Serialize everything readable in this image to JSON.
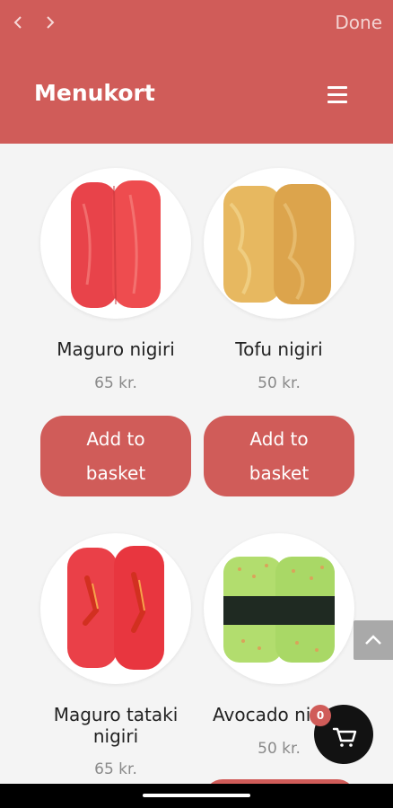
{
  "browser": {
    "back_icon": "chevron-left-icon",
    "forward_icon": "chevron-right-icon",
    "done_label": "Done"
  },
  "header": {
    "title": "Menukort",
    "menu_icon": "hamburger-icon"
  },
  "products": [
    {
      "name": "Maguro nigiri",
      "price": "65 kr.",
      "button_label_line1": "Add to",
      "button_label_line2": "basket"
    },
    {
      "name": "Tofu nigiri",
      "price": "50 kr.",
      "button_label_line1": "Add to",
      "button_label_line2": "basket"
    },
    {
      "name": "Maguro tataki nigiri",
      "price": "65 kr."
    },
    {
      "name": "Avocado ni",
      "price": "50 kr."
    }
  ],
  "cart": {
    "count": "0",
    "icon": "cart-icon"
  },
  "scroll_top": {
    "icon": "chevron-up-icon"
  },
  "colors": {
    "brand": "#d05c59",
    "background": "#f4f4f4",
    "cart_button": "#121212"
  }
}
